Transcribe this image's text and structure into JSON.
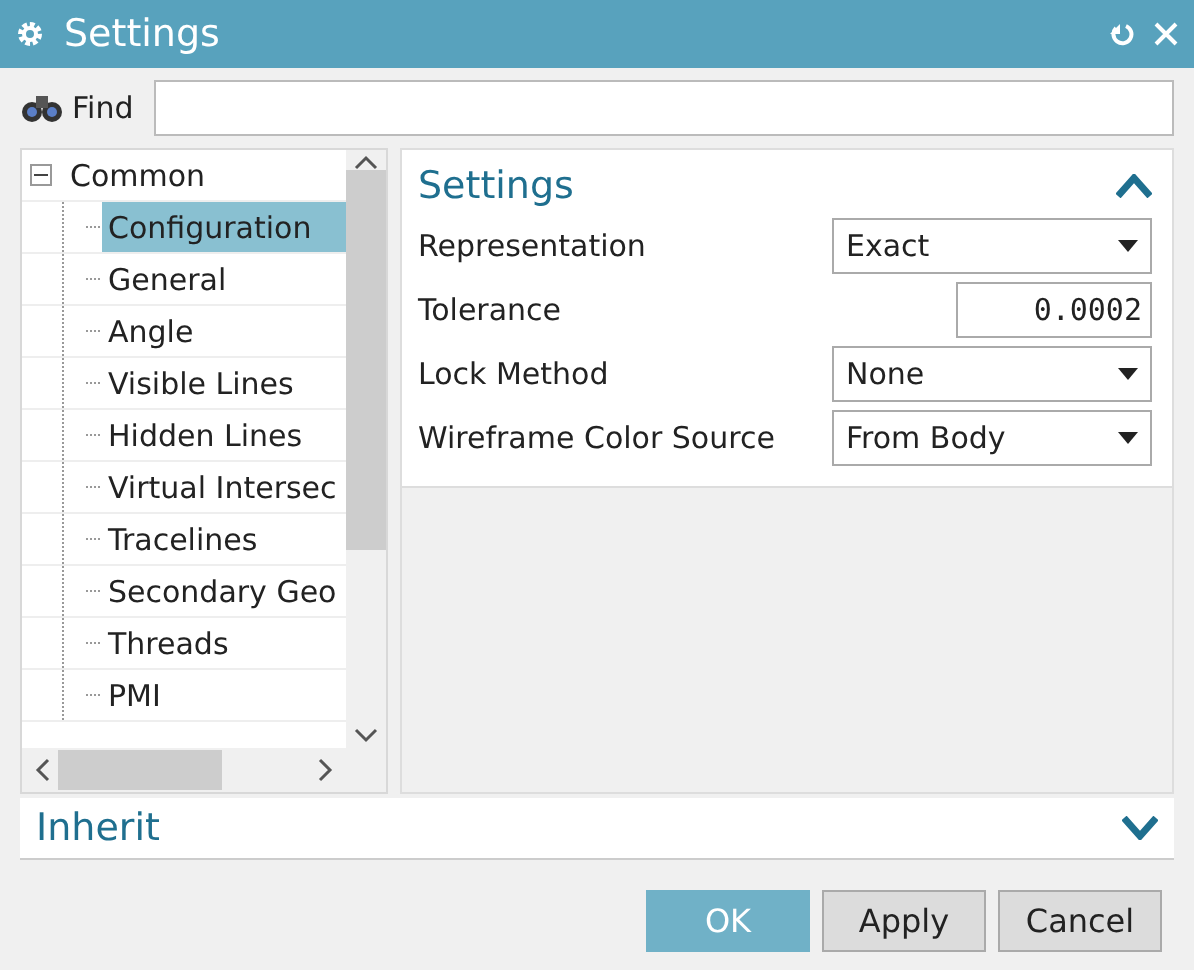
{
  "window": {
    "title": "Settings"
  },
  "find": {
    "label": "Find"
  },
  "tree": [
    {
      "label": "Common",
      "expanded": true,
      "selected": false,
      "children": [
        {
          "label": "Configuration",
          "selected": true
        },
        {
          "label": "General",
          "selected": false
        },
        {
          "label": "Angle",
          "selected": false
        },
        {
          "label": "Visible Lines",
          "selected": false
        },
        {
          "label": "Hidden Lines",
          "selected": false
        },
        {
          "label": "Virtual Intersec",
          "selected": false
        },
        {
          "label": "Tracelines",
          "selected": false
        },
        {
          "label": "Secondary Geo",
          "selected": false
        },
        {
          "label": "Threads",
          "selected": false
        },
        {
          "label": "PMI",
          "selected": false
        }
      ]
    }
  ],
  "settings_group": {
    "title": "Settings",
    "expanded": true,
    "fields": [
      {
        "label": "Representation",
        "kind": "dropdown",
        "value": "Exact"
      },
      {
        "label": "Tolerance",
        "kind": "number",
        "value": "0.0002"
      },
      {
        "label": "Lock Method",
        "kind": "dropdown",
        "value": "None"
      },
      {
        "label": "Wireframe Color Source",
        "kind": "dropdown",
        "value": "From Body"
      }
    ]
  },
  "inherit_group": {
    "title": "Inherit",
    "expanded": false
  },
  "buttons": [
    {
      "label": "OK",
      "primary": true
    },
    {
      "label": "Apply",
      "primary": false
    },
    {
      "label": "Cancel",
      "primary": false
    }
  ]
}
